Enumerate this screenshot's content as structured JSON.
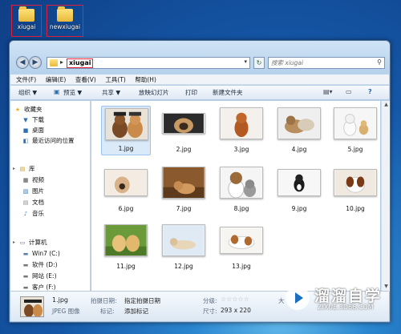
{
  "desktop": {
    "icons": [
      {
        "label": "xiugai"
      },
      {
        "label": "newxiugai"
      }
    ]
  },
  "window": {
    "address": {
      "path": "xiugai"
    },
    "search": {
      "placeholder": "搜索 xiugai"
    },
    "menu": [
      "文件(F)",
      "编辑(E)",
      "查看(V)",
      "工具(T)",
      "帮助(H)"
    ],
    "toolbar": {
      "organize": "组织 ▼",
      "preview": "预览 ▼",
      "share": "共享 ▼",
      "slideshow": "放映幻灯片",
      "print": "打印",
      "new_folder": "新建文件夹"
    },
    "sidebar": {
      "favorites": "收藏夹",
      "fav_items": [
        "下载",
        "桌面",
        "最近访问的位置"
      ],
      "libraries": "库",
      "lib_items": [
        "视频",
        "图片",
        "文档",
        "音乐"
      ],
      "computer": "计算机",
      "drives": [
        "Win7 (C:)",
        "软件 (D:)",
        "网站 (E:)",
        "客户 (F:)"
      ]
    },
    "files": [
      {
        "name": "1.jpg"
      },
      {
        "name": "2.jpg"
      },
      {
        "name": "3.jpg"
      },
      {
        "name": "4.jpg"
      },
      {
        "name": "5.jpg"
      },
      {
        "name": "6.jpg"
      },
      {
        "name": "7.jpg"
      },
      {
        "name": "8.jpg"
      },
      {
        "name": "9.jpg"
      },
      {
        "name": "10.jpg"
      },
      {
        "name": "11.jpg"
      },
      {
        "name": "12.jpg"
      },
      {
        "name": "13.jpg"
      }
    ],
    "details": {
      "filename": "1.jpg",
      "filetype": "JPEG 图像",
      "date_label": "拍摄日期:",
      "date_value": "指定拍摄日期",
      "tags_label": "标记:",
      "tags_value": "添加标记",
      "rating_label": "分级:",
      "size_label": "尺寸:",
      "size_value": "293 x 220",
      "truncated": "大"
    }
  },
  "watermark": {
    "title": "溜溜自学",
    "url": "ZIXUE.3D66.COM"
  },
  "colors": {
    "highlight": "#e0203a",
    "selection": "#dbeaf9"
  }
}
